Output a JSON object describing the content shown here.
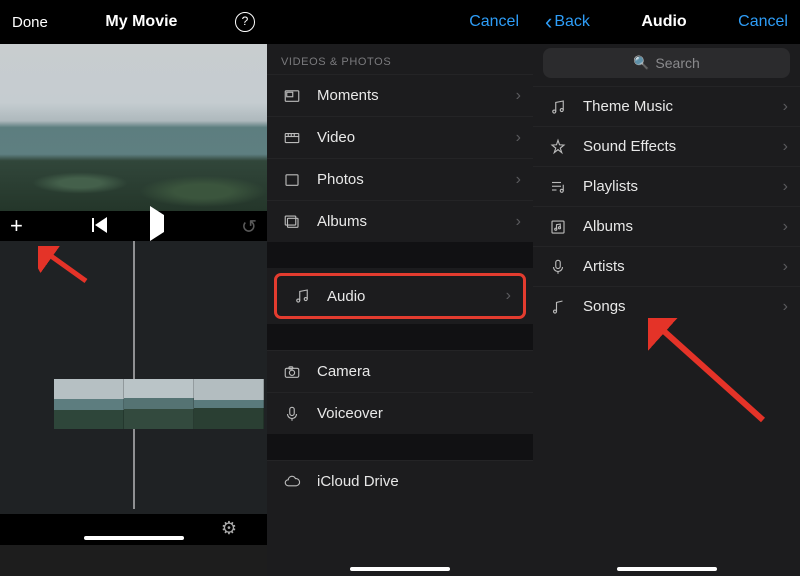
{
  "left": {
    "done": "Done",
    "title": "My Movie"
  },
  "mid": {
    "cancel": "Cancel",
    "section": "VIDEOS & PHOTOS",
    "rows": {
      "moments": "Moments",
      "video": "Video",
      "photos": "Photos",
      "albums": "Albums",
      "audio": "Audio",
      "camera": "Camera",
      "voiceover": "Voiceover",
      "icloud": "iCloud Drive"
    }
  },
  "right": {
    "back": "Back",
    "title": "Audio",
    "cancel": "Cancel",
    "search_placeholder": "Search",
    "rows": {
      "theme": "Theme Music",
      "sfx": "Sound Effects",
      "playlists": "Playlists",
      "albums": "Albums",
      "artists": "Artists",
      "songs": "Songs"
    }
  }
}
